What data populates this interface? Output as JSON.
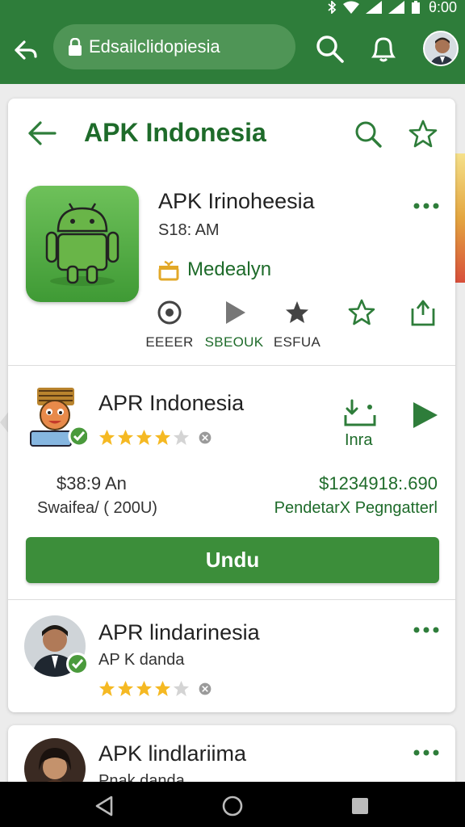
{
  "status_bar": {
    "time": "θ:00"
  },
  "browser_bar": {
    "url": "Edsailclidopiesia"
  },
  "header": {
    "title": "APK Indonesia"
  },
  "app": {
    "name": "APK Irinoheesia",
    "time": "S18: AM",
    "developer": "Medealyn",
    "actions": [
      {
        "label": "ΕΕΕΕR",
        "icon": "target-icon"
      },
      {
        "label": "SBEOUK",
        "icon": "play-icon"
      },
      {
        "label": "ESFUA",
        "icon": "star-filled-icon"
      },
      {
        "label": "",
        "icon": "star-outline-icon"
      },
      {
        "label": "",
        "icon": "share-icon"
      }
    ]
  },
  "listing1": {
    "name": "APR Indonesia",
    "rating": 4,
    "download_label": "Inra",
    "price_left": "$38:9 An",
    "sub_left": "Swaifea/ ( 200U)",
    "price_right": "$1234918:.690",
    "sub_right": "PendetarX Pegngatterl",
    "button_label": "Undu"
  },
  "listing2": {
    "name": "APR lindarinesia",
    "subtitle": "AP K danda",
    "rating": 4
  },
  "listing3": {
    "name": "APK lindlariima",
    "subtitle": "Pnak danda"
  },
  "colors": {
    "brand_green": "#2e7d3a",
    "accent_green": "#1e6b2a",
    "button_green": "#3c8e3a",
    "star_yellow": "#f5b923"
  }
}
